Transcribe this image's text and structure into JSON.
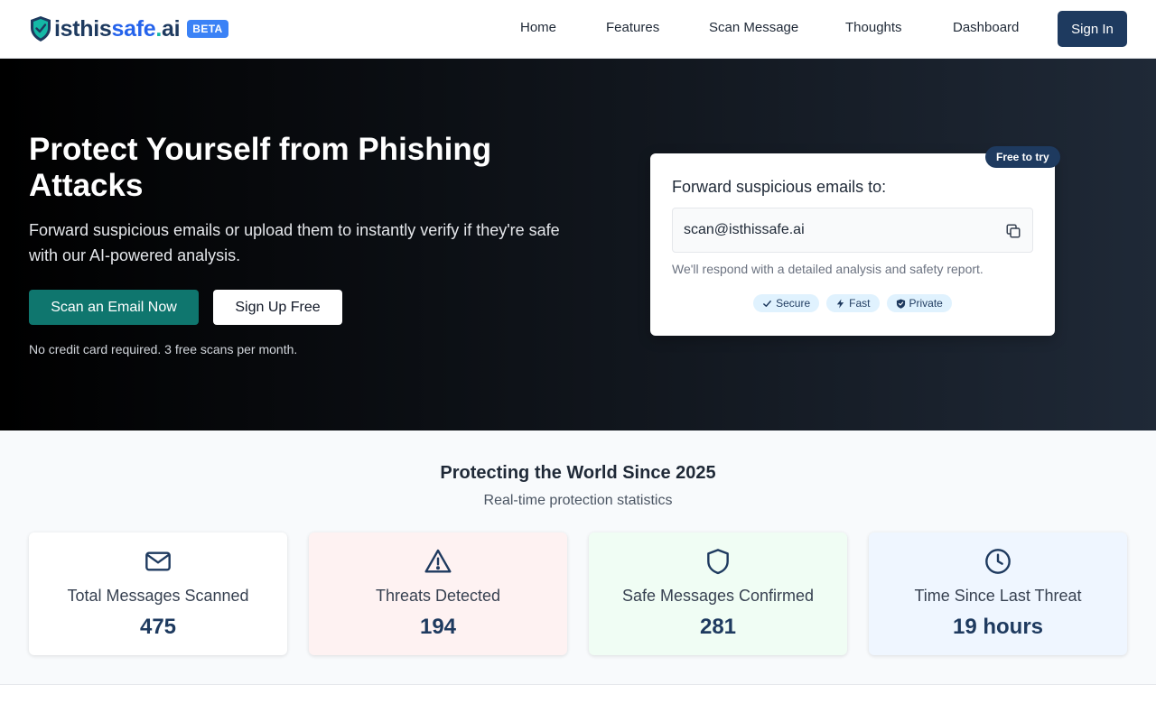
{
  "header": {
    "logo": {
      "part1": "isthis",
      "part2": "safe",
      "dot": ".",
      "part3": "ai"
    },
    "beta_label": "BETA",
    "nav": [
      "Home",
      "Features",
      "Scan Message",
      "Thoughts",
      "Dashboard"
    ],
    "sign_in": "Sign In"
  },
  "hero": {
    "title": "Protect Yourself from Phishing Attacks",
    "subtitle": "Forward suspicious emails or upload them to instantly verify if they're safe with our AI-powered analysis.",
    "primary_button": "Scan an Email Now",
    "secondary_button": "Sign Up Free",
    "note": "No credit card required. 3 free scans per month."
  },
  "forward_card": {
    "badge": "Free to try",
    "title": "Forward suspicious emails to:",
    "email": "scan@isthissafe.ai",
    "note": "We'll respond with a detailed analysis and safety report.",
    "chips": [
      {
        "label": "Secure",
        "icon": "check-icon"
      },
      {
        "label": "Fast",
        "icon": "bolt-icon"
      },
      {
        "label": "Private",
        "icon": "shield-check-icon"
      }
    ]
  },
  "stats": {
    "title": "Protecting the World Since 2025",
    "subtitle": "Real-time protection statistics",
    "cards": [
      {
        "label": "Total Messages Scanned",
        "value": "475",
        "icon": "envelope-icon",
        "bg": "#ffffff"
      },
      {
        "label": "Threats Detected",
        "value": "194",
        "icon": "warning-icon",
        "bg": "#fef2f2"
      },
      {
        "label": "Safe Messages Confirmed",
        "value": "281",
        "icon": "shield-icon",
        "bg": "#f0fdf4"
      },
      {
        "label": "Time Since Last Threat",
        "value": "19 hours",
        "icon": "clock-icon",
        "bg": "#eff6ff"
      }
    ]
  },
  "colors": {
    "brand_navy": "#1e3a5f",
    "primary_teal": "#0f766e",
    "beta_blue": "#3b82f6"
  }
}
